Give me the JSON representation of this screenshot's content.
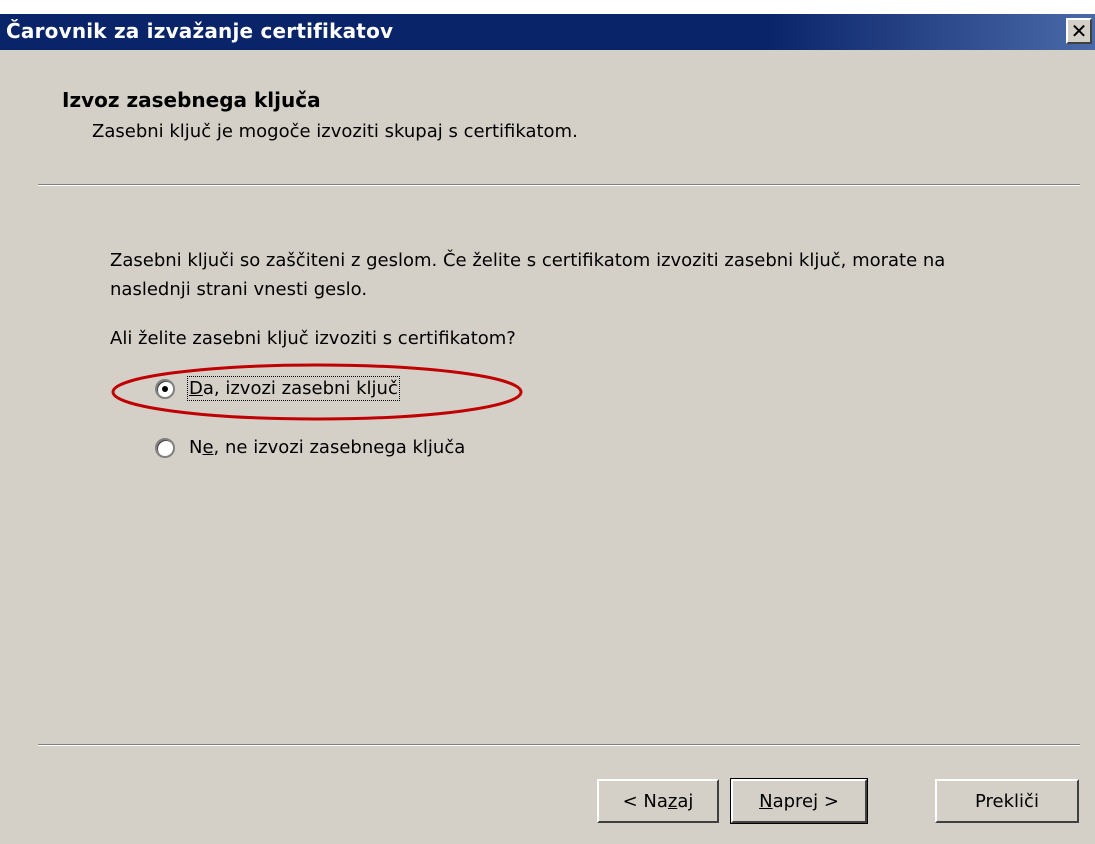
{
  "window": {
    "title": "Čarovnik za izvažanje certifikatov",
    "close_symbol": "✕"
  },
  "header": {
    "title": "Izvoz zasebnega ključa",
    "subtitle": "Zasebni ključ je mogoče izvoziti skupaj s certifikatom."
  },
  "content": {
    "description": "Zasebni ključi so zaščiteni z geslom. Če želite s certifikatom izvoziti zasebni ključ, morate na naslednji strani vnesti geslo.",
    "question": "Ali želite zasebni ključ izvoziti s certifikatom?"
  },
  "options": {
    "yes": {
      "mnemonic": "D",
      "rest": "a, izvozi zasebni ključ",
      "selected": true
    },
    "no": {
      "before": "N",
      "mnemonic": "e",
      "rest": ", ne izvozi zasebnega ključa",
      "selected": false
    }
  },
  "buttons": {
    "back": {
      "before": "< Na",
      "mnemonic": "z",
      "after": "aj"
    },
    "next": {
      "mnemonic": "N",
      "after": "aprej >"
    },
    "cancel": "Prekliči"
  },
  "colors": {
    "titlebar": "#0a246a",
    "dialog_bg": "#d4d0c8",
    "annotation": "#c00000"
  },
  "icons": {
    "close": "close-icon",
    "radio_selected": "radio-selected-icon",
    "radio_unselected": "radio-unselected-icon"
  }
}
